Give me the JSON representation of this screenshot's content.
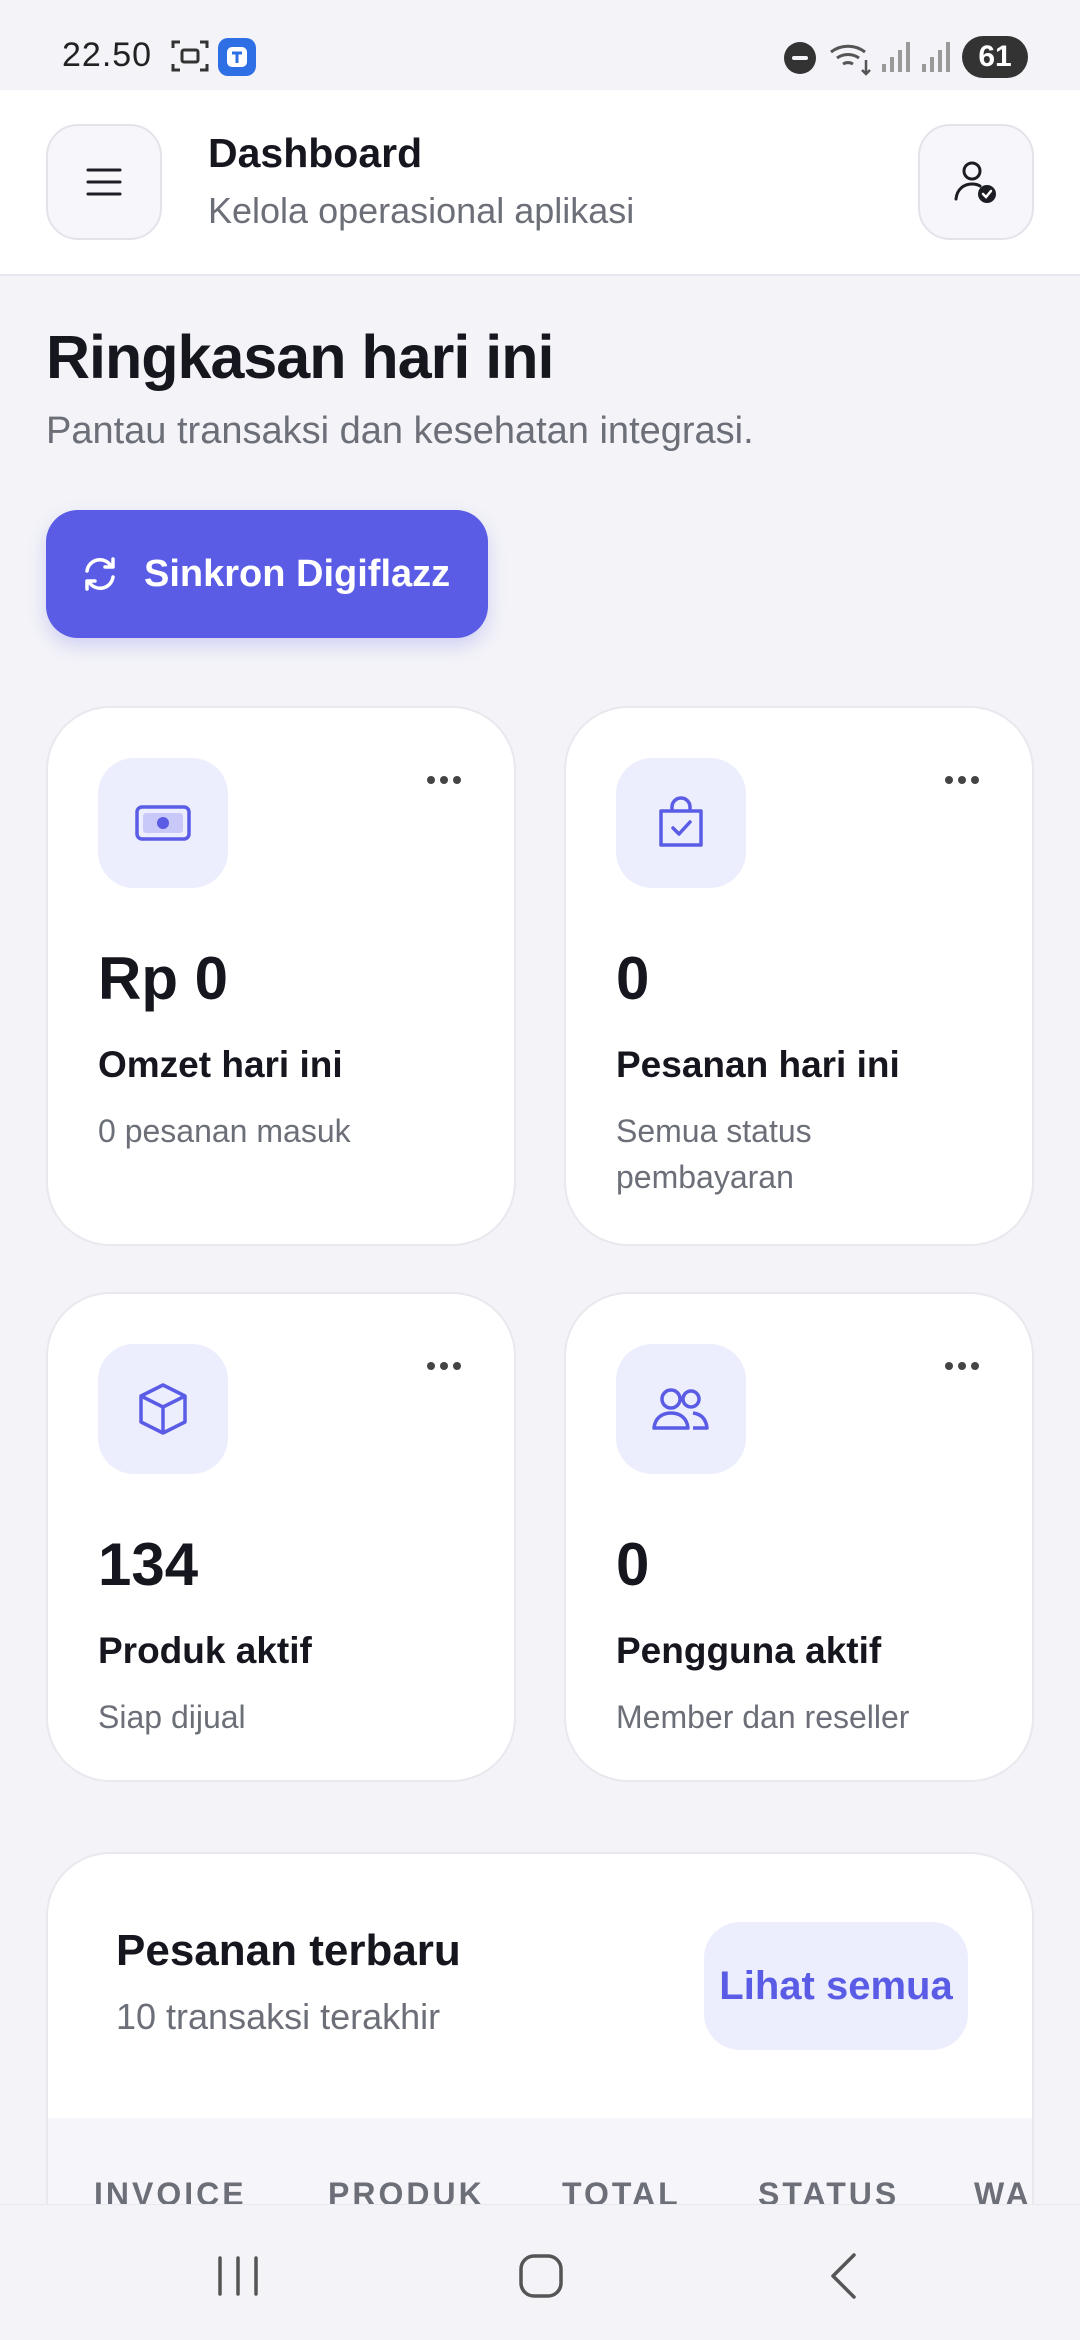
{
  "status_bar": {
    "time": "22.50",
    "battery": "61"
  },
  "header": {
    "title": "Dashboard",
    "subtitle": "Kelola operasional aplikasi"
  },
  "summary": {
    "title": "Ringkasan hari ini",
    "subtitle": "Pantau transaksi dan kesehatan integrasi.",
    "sync_label": "Sinkron Digiflazz"
  },
  "stats": [
    {
      "value": "Rp 0",
      "label": "Omzet hari ini",
      "note": "0 pesanan masuk",
      "icon": "banknote-icon"
    },
    {
      "value": "0",
      "label": "Pesanan hari ini",
      "note": "Semua status pembayaran",
      "icon": "shopping-bag-check-icon"
    },
    {
      "value": "134",
      "label": "Produk aktif",
      "note": "Siap dijual",
      "icon": "box-icon"
    },
    {
      "value": "0",
      "label": "Pengguna aktif",
      "note": "Member dan reseller",
      "icon": "users-icon"
    }
  ],
  "recent_orders": {
    "title": "Pesanan terbaru",
    "subtitle": "10 transaksi terakhir",
    "view_all_label": "Lihat semua",
    "columns": [
      "INVOICE",
      "PRODUK",
      "TOTAL",
      "STATUS",
      "WAKTU"
    ]
  },
  "colors": {
    "accent": "#5a5ce6",
    "accent_soft": "#eceefe",
    "background": "#f3f3f8",
    "text_primary": "#16161f",
    "text_muted": "#6c6f78"
  }
}
